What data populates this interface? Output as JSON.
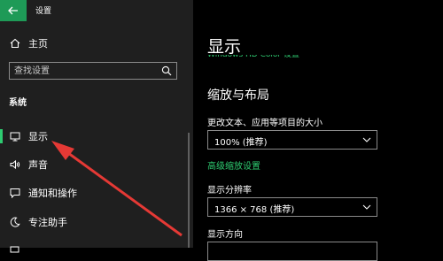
{
  "window": {
    "title": "设置"
  },
  "sidebar": {
    "home": "主页",
    "search": {
      "placeholder": "查找设置"
    },
    "section": "系统",
    "items": [
      {
        "label": "显示",
        "icon": "monitor-icon",
        "active": true
      },
      {
        "label": "声音",
        "icon": "speaker-icon"
      },
      {
        "label": "通知和操作",
        "icon": "notification-icon"
      },
      {
        "label": "专注助手",
        "icon": "moon-icon"
      }
    ]
  },
  "main": {
    "title": "显示",
    "cut_link": "Windows HD Color 设置",
    "subhead": "缩放与布局",
    "scale": {
      "label": "更改文本、应用等项目的大小",
      "value": "100% (推荐)"
    },
    "advanced_link": "高级缩放设置",
    "resolution": {
      "label": "显示分辨率",
      "value": "1366 × 768 (推荐)"
    },
    "orientation": {
      "label": "显示方向"
    }
  },
  "colors": {
    "accent": "#2ecc71",
    "back_button": "#1e9a57",
    "annotation_arrow": "#e53935"
  }
}
